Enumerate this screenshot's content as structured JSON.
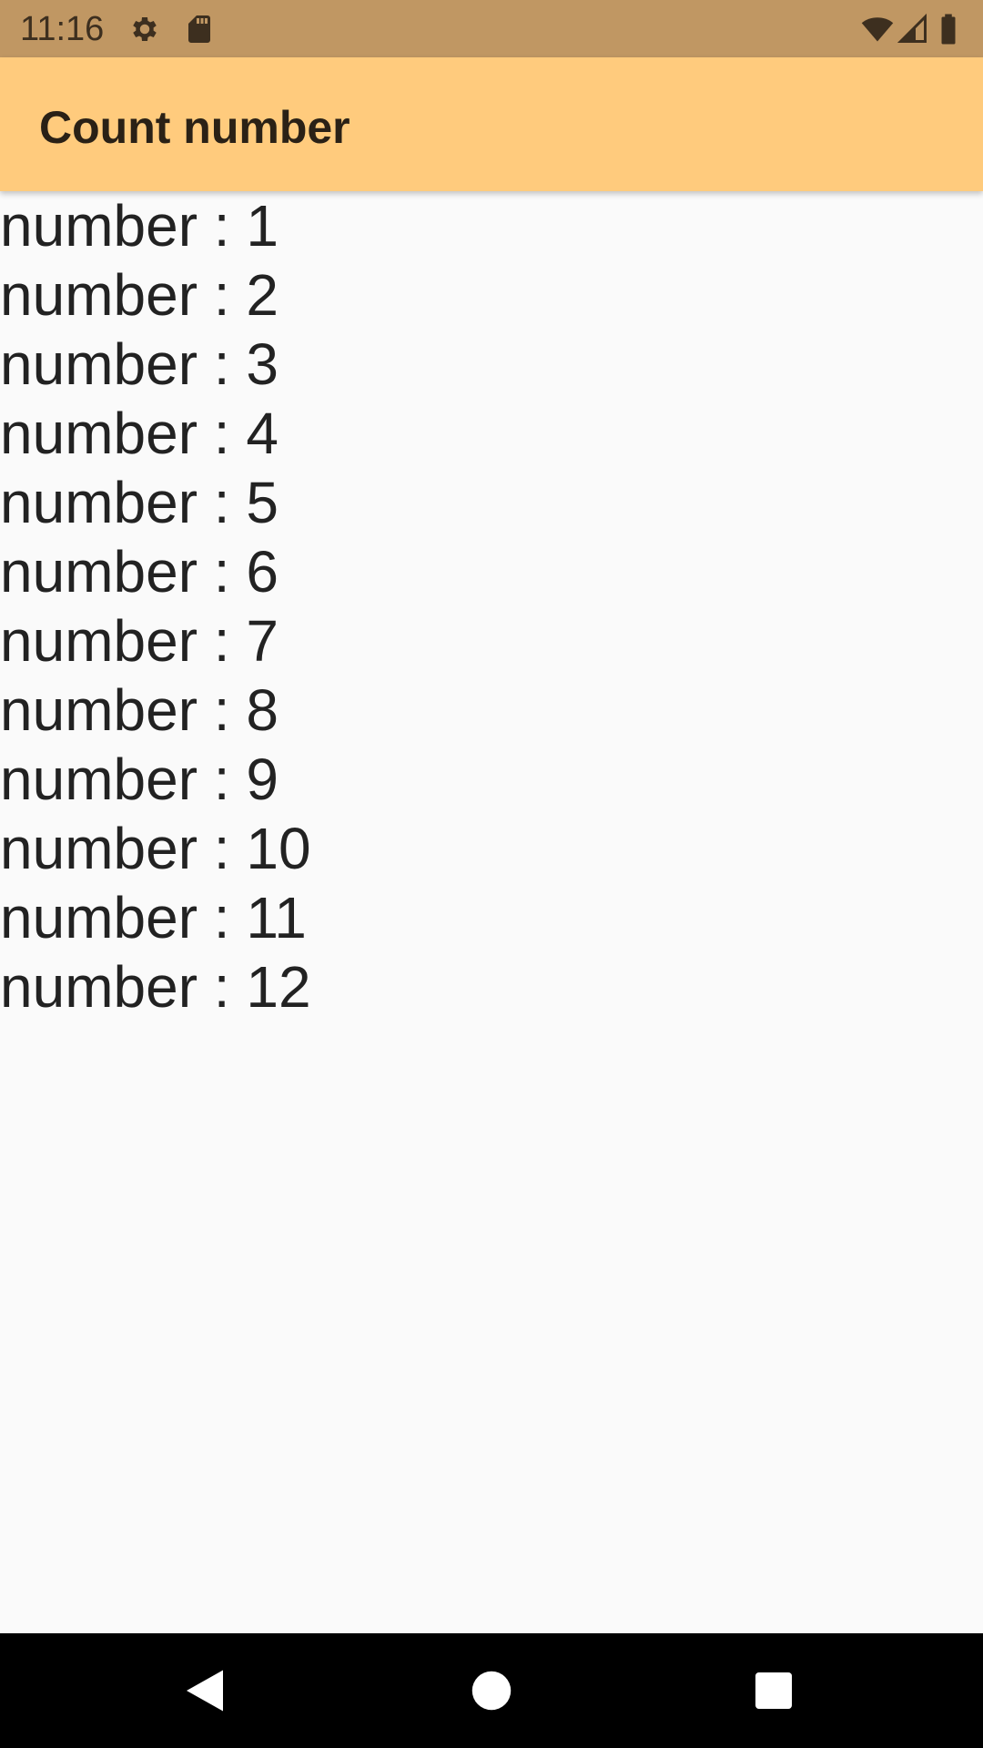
{
  "status_bar": {
    "time": "11:16",
    "icons": [
      "gear-icon",
      "sd-card-icon",
      "wifi-icon",
      "signal-icon",
      "battery-icon"
    ],
    "color": "#c09763"
  },
  "app_bar": {
    "title": "Count number",
    "color": "#ffcb7d"
  },
  "list": {
    "items": [
      "number : 1",
      "number : 2",
      "number : 3",
      "number : 4",
      "number : 5",
      "number : 6",
      "number : 7",
      "number : 8",
      "number : 9",
      "number : 10",
      "number : 11",
      "number : 12"
    ]
  },
  "nav_bar": {
    "buttons": [
      "back-icon",
      "home-icon",
      "recents-icon"
    ]
  }
}
